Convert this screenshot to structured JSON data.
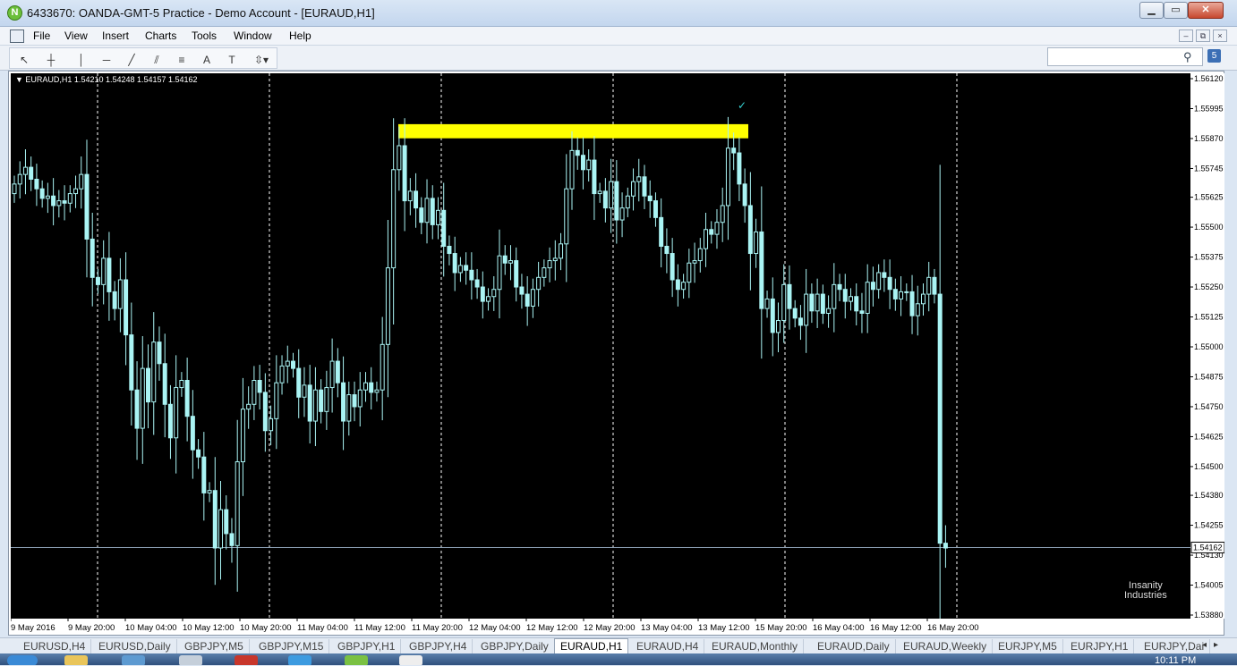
{
  "window": {
    "title": "6433670: OANDA-GMT-5 Practice - Demo Account - [EURAUD,H1]",
    "min_label": "▁",
    "max_label": "▭",
    "close_label": "✕"
  },
  "menu": {
    "items": [
      "File",
      "View",
      "Insert",
      "Charts",
      "Tools",
      "Window",
      "Help"
    ],
    "mdi_min": "–",
    "mdi_restore": "⧉",
    "mdi_close": "×"
  },
  "toolbar": {
    "tools": [
      {
        "icon": "cursor-icon",
        "glyph": "↖"
      },
      {
        "icon": "crosshair-icon",
        "glyph": "┼"
      },
      {
        "icon": "vertical-line-icon",
        "glyph": "│"
      },
      {
        "icon": "horizontal-line-icon",
        "glyph": "─"
      },
      {
        "icon": "trendline-icon",
        "glyph": "╱"
      },
      {
        "icon": "equidistant-channel-icon",
        "glyph": "⫽"
      },
      {
        "icon": "fibonacci-icon",
        "glyph": "≡"
      },
      {
        "icon": "text-icon",
        "glyph": "A"
      },
      {
        "icon": "text-label-icon",
        "glyph": "T"
      },
      {
        "icon": "arrows-icon",
        "glyph": "⇳▾"
      }
    ]
  },
  "search": {
    "placeholder": "",
    "help_badge": "5"
  },
  "chart": {
    "symbol_label": "EURAUD,H1  1.54210 1.54248 1.54157 1.54162",
    "watermark_line1": "Insanity",
    "watermark_line2": "Industries",
    "current_price": "1.54162",
    "colors": {
      "background": "#000000",
      "candle": "#aaf4f4",
      "highlight": "#ffff00",
      "separator": "#ffffff"
    }
  },
  "chart_data": {
    "type": "candlestick",
    "symbol": "EURAUD",
    "timeframe": "H1",
    "ohlc_current": {
      "open": 1.5421,
      "high": 1.54248,
      "low": 1.54157,
      "close": 1.54162
    },
    "y_ticks": [
      "1.56120",
      "1.55995",
      "1.55870",
      "1.55745",
      "1.55625",
      "1.55500",
      "1.55375",
      "1.55250",
      "1.55125",
      "1.55000",
      "1.54875",
      "1.54750",
      "1.54625",
      "1.54500",
      "1.54380",
      "1.54255",
      "1.54130",
      "1.54005",
      "1.53880"
    ],
    "ylim": [
      1.5388,
      1.5612
    ],
    "x_ticks": [
      "9 May 2016",
      "9 May 20:00",
      "10 May 04:00",
      "10 May 12:00",
      "10 May 20:00",
      "11 May 04:00",
      "11 May 12:00",
      "11 May 20:00",
      "12 May 04:00",
      "12 May 12:00",
      "12 May 20:00",
      "13 May 04:00",
      "13 May 12:00",
      "15 May 20:00",
      "16 May 04:00",
      "16 May 12:00",
      "16 May 20:00"
    ],
    "closes": [
      1.5568,
      1.5572,
      1.5575,
      1.557,
      1.5566,
      1.5562,
      1.5563,
      1.5559,
      1.5561,
      1.556,
      1.5564,
      1.5566,
      1.5572,
      1.5545,
      1.5529,
      1.5526,
      1.5537,
      1.5523,
      1.5516,
      1.5528,
      1.5505,
      1.5482,
      1.5466,
      1.5491,
      1.5477,
      1.5502,
      1.5493,
      1.5476,
      1.5462,
      1.5483,
      1.5486,
      1.5471,
      1.5457,
      1.5454,
      1.5439,
      1.544,
      1.5416,
      1.5432,
      1.5422,
      1.5417,
      1.5452,
      1.5474,
      1.5476,
      1.5486,
      1.5481,
      1.5465,
      1.547,
      1.5485,
      1.5492,
      1.5494,
      1.5491,
      1.5479,
      1.5484,
      1.5469,
      1.5482,
      1.5473,
      1.5483,
      1.5494,
      1.5485,
      1.5469,
      1.548,
      1.5475,
      1.5482,
      1.5485,
      1.5481,
      1.5482,
      1.5501,
      1.5533,
      1.5574,
      1.5584,
      1.5561,
      1.5565,
      1.5558,
      1.5552,
      1.5562,
      1.5551,
      1.5557,
      1.5542,
      1.5539,
      1.5531,
      1.5534,
      1.5532,
      1.5528,
      1.5525,
      1.5519,
      1.5521,
      1.5524,
      1.5538,
      1.5535,
      1.5536,
      1.5525,
      1.5522,
      1.5517,
      1.5524,
      1.5529,
      1.5533,
      1.5536,
      1.5537,
      1.5543,
      1.5566,
      1.5582,
      1.558,
      1.5574,
      1.5578,
      1.5564,
      1.5565,
      1.5558,
      1.5569,
      1.5553,
      1.5558,
      1.5563,
      1.5569,
      1.5571,
      1.5563,
      1.5561,
      1.5554,
      1.5542,
      1.5539,
      1.5528,
      1.5524,
      1.5527,
      1.5535,
      1.5536,
      1.5541,
      1.5549,
      1.5547,
      1.5552,
      1.5559,
      1.5583,
      1.5581,
      1.5568,
      1.5559,
      1.5539,
      1.5548,
      1.5516,
      1.552,
      1.5506,
      1.5511,
      1.5526,
      1.5516,
      1.5512,
      1.5509,
      1.5522,
      1.5515,
      1.5522,
      1.5514,
      1.5516,
      1.5526,
      1.5524,
      1.5519,
      1.5521,
      1.5515,
      1.5514,
      1.5527,
      1.5524,
      1.5531,
      1.5529,
      1.5524,
      1.552,
      1.5523,
      1.5523,
      1.5513,
      1.5518,
      1.5522,
      1.5529,
      1.5522,
      1.5418,
      1.5416
    ],
    "highlight_zone": {
      "from_price": 1.55871,
      "to_price": 1.5593
    },
    "current_price_line": 1.54162,
    "grid": false,
    "period_separators": true
  },
  "tabs": [
    "EURUSD,H4",
    "EURUSD,Daily",
    "GBPJPY,M5",
    "GBPJPY,M15",
    "GBPJPY,H1",
    "GBPJPY,H4",
    "GBPJPY,Daily",
    "EURAUD,H1",
    "EURAUD,H4",
    "EURAUD,Monthly",
    "EURAUD,Daily",
    "EURAUD,Weekly",
    "EURJPY,M5",
    "EURJPY,H1",
    "EURJPY,Dai"
  ],
  "active_tab": "EURAUD,H1",
  "taskbar": {
    "clock": "10:11 PM"
  }
}
